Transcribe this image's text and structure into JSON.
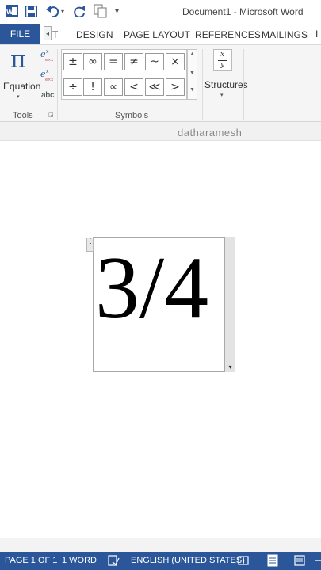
{
  "window": {
    "title": "Document1 - Microsoft Word"
  },
  "quick_access": {
    "customize_icon": "▾"
  },
  "tabs": [
    {
      "label": "FILE"
    },
    {
      "label": "T"
    },
    {
      "label": "DESIGN"
    },
    {
      "label": "PAGE LAYOUT"
    },
    {
      "label": "REFERENCES"
    },
    {
      "label": "MAILINGS"
    }
  ],
  "tools_group": {
    "equation_glyph": "π",
    "equation_label": "Equation",
    "label": "Tools",
    "ink_label": "abc"
  },
  "symbols_group": {
    "label": "Symbols",
    "row1": [
      "±",
      "∞",
      "=",
      "≠",
      "~",
      "×"
    ],
    "row2": [
      "÷",
      "!",
      "∝",
      "<",
      "≪",
      ">"
    ]
  },
  "structures_group": {
    "numerator": "x",
    "denominator": "y",
    "label": "Structures"
  },
  "user_bar": {
    "name": "datharamesh"
  },
  "equation": {
    "text": "3/4"
  },
  "status": {
    "page": "PAGE 1 OF 1",
    "words": "1 WORD",
    "language": "ENGLISH (UNITED STATES)"
  }
}
